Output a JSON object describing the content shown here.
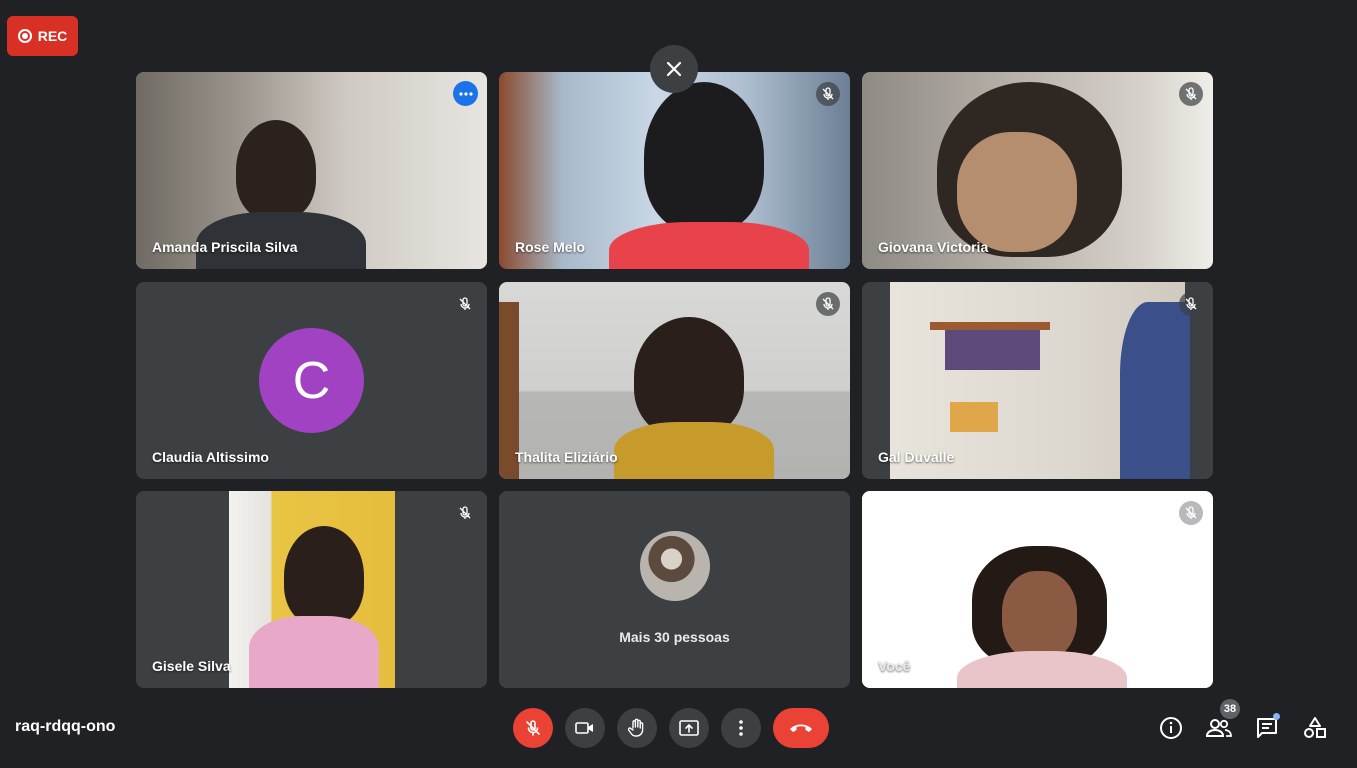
{
  "recording": {
    "label": "REC"
  },
  "tiles": [
    {
      "name": "Amanda Priscila Silva"
    },
    {
      "name": "Rose Melo"
    },
    {
      "name": "Giovana Victoria"
    },
    {
      "name": "Claudia Altissimo",
      "initial": "C",
      "avatar_color": "#a142c3"
    },
    {
      "name": "Thalita Eliziário"
    },
    {
      "name": "Gal Duvalle"
    },
    {
      "name": "Gisele Silva"
    },
    {
      "more_label": "Mais 30 pessoas"
    },
    {
      "name": "Você"
    }
  ],
  "footer": {
    "meeting_code": "raq-rdqq-ono",
    "participants_count": "38"
  },
  "colors": {
    "accent": "#8ab4f8",
    "danger": "#ea4335",
    "background": "#202124",
    "tile": "#3c4043"
  }
}
